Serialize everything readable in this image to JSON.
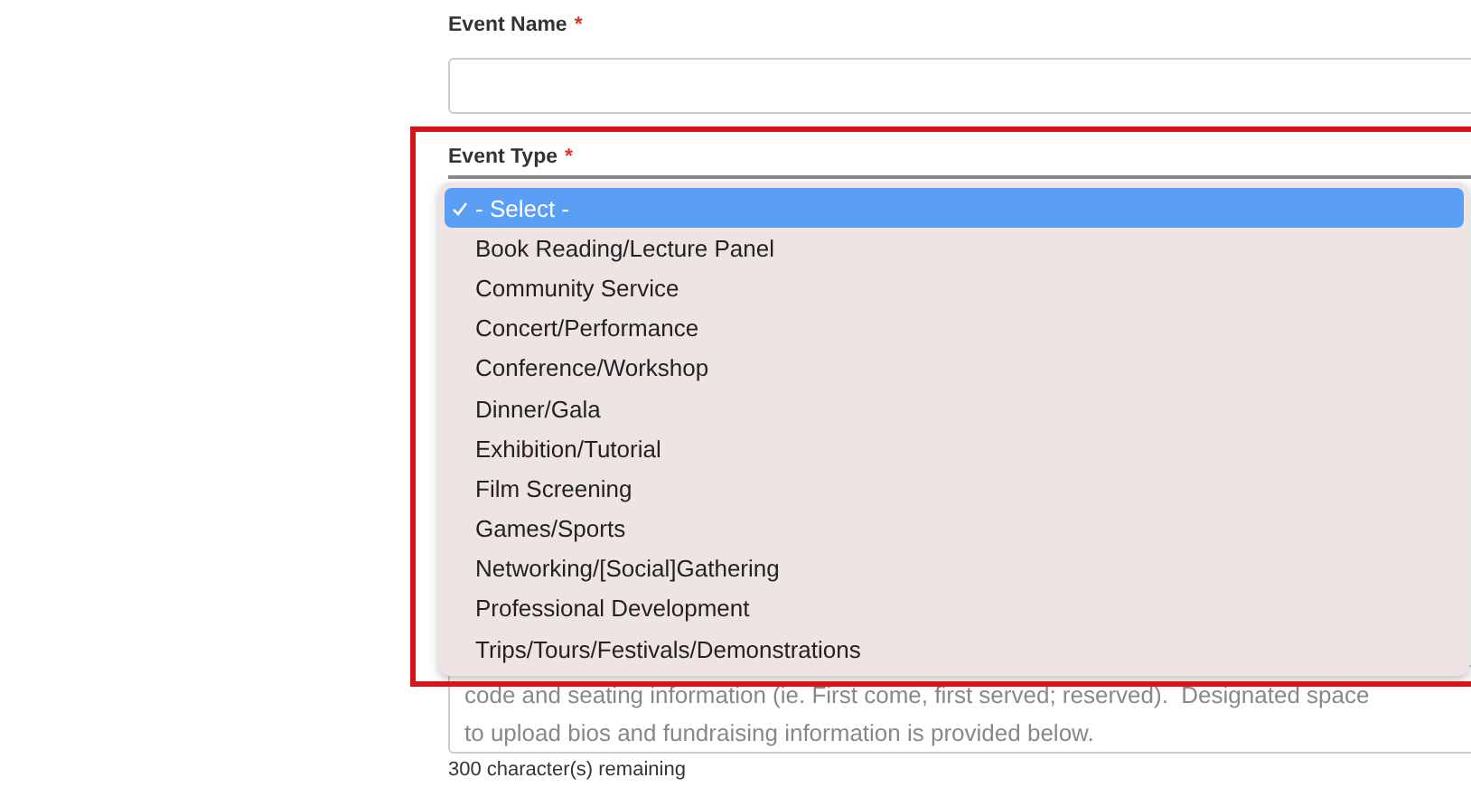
{
  "fields": [
    {
      "kind": "text",
      "label": "Event Name",
      "required": true,
      "required_mark": "*"
    },
    {
      "kind": "select",
      "label": "Event Type",
      "required": true,
      "required_mark": "*",
      "highlighted": true,
      "options": [
        {
          "label": "- Select -",
          "selected": true
        },
        {
          "label": "Book Reading/Lecture Panel",
          "selected": false
        },
        {
          "label": "Community Service",
          "selected": false
        },
        {
          "label": "Concert/Performance",
          "selected": false
        },
        {
          "label": "Conference/Workshop",
          "selected": false
        },
        {
          "label": "Dinner/Gala",
          "selected": false
        },
        {
          "label": "Exhibition/Tutorial",
          "selected": false
        },
        {
          "label": "Film Screening",
          "selected": false
        },
        {
          "label": "Games/Sports",
          "selected": false
        },
        {
          "label": "Networking/[Social]Gathering",
          "selected": false
        },
        {
          "label": "Professional Development",
          "selected": false
        },
        {
          "label": "Trips/Tours/Festivals/Demonstrations",
          "selected": false
        }
      ]
    },
    {
      "kind": "textarea",
      "placeholder": "code and seating information (ie. First come, first served; reserved).  Designated space\nto upload bios and fundraising information is provided below.",
      "counter": "300 character(s) remaining"
    }
  ]
}
